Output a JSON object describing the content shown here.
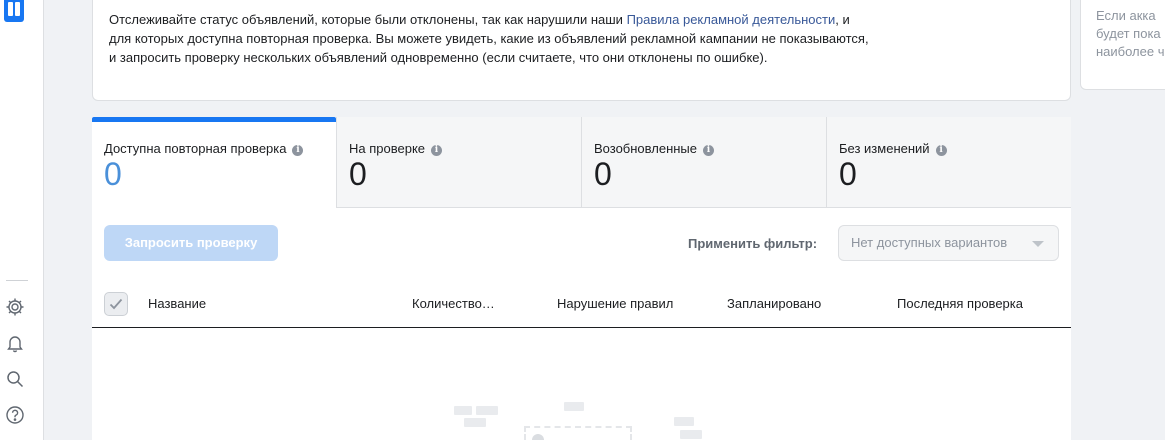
{
  "info": {
    "text_before": "Отслеживайте статус объявлений, которые были отклонены, так как нарушили наши ",
    "link": "Правила рекламной деятельности",
    "text_after": ", и для которых доступна повторная проверка. Вы можете увидеть, какие из объявлений рекламной кампании не показываются, и запросить проверку нескольких объявлений одновременно (если считаете, что они отклонены по ошибке)."
  },
  "right_card": {
    "text": "Если акка\nбудет пока\nнаиболее ч"
  },
  "tabs": [
    {
      "label": "Доступна повторная проверка",
      "count": "0",
      "active": true
    },
    {
      "label": "На проверке",
      "count": "0",
      "active": false
    },
    {
      "label": "Возобновленные",
      "count": "0",
      "active": false
    },
    {
      "label": "Без изменений",
      "count": "0",
      "active": false
    }
  ],
  "toolbar": {
    "request_label": "Запросить проверку",
    "filter_label": "Применить фильтр:",
    "filter_value": "Нет доступных вариантов"
  },
  "table": {
    "columns": [
      "Название",
      "Количество…",
      "Нарушение правил",
      "Запланировано",
      "Последняя проверка"
    ]
  },
  "colors": {
    "accent": "#1877f2",
    "active_count": "#4a90d9",
    "link": "#385898",
    "disabled_button": "#bed7f6"
  },
  "rail_icons": [
    "app-icon",
    "gear-icon",
    "bell-icon",
    "search-icon",
    "help-icon"
  ]
}
